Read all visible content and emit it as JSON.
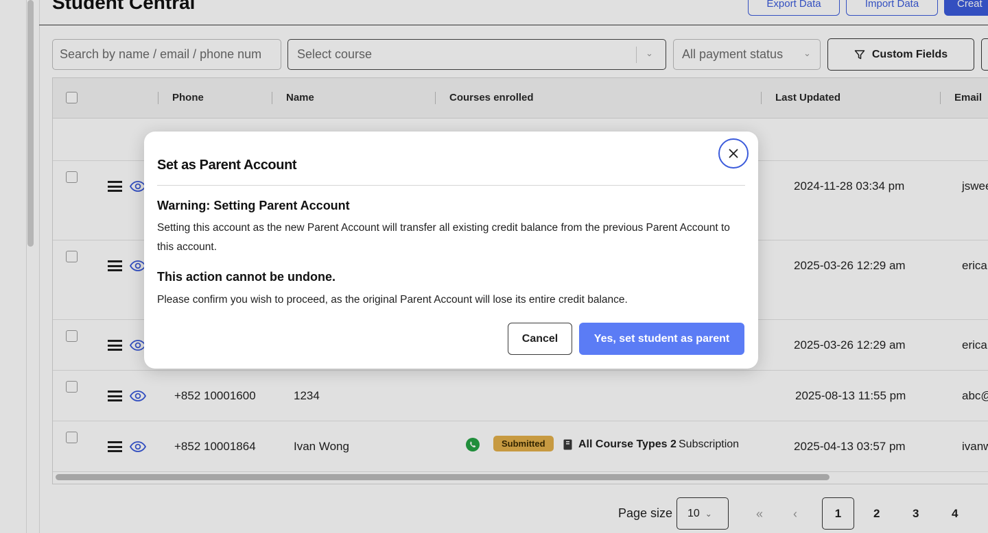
{
  "header": {
    "title": "Student Central",
    "buttons": {
      "export": "Export Data",
      "import": "Import Data",
      "create": "Creat"
    }
  },
  "filters": {
    "search_placeholder": "Search by name / email / phone num",
    "course_placeholder": "Select course",
    "payment_status": "All payment status",
    "custom_fields": "Custom Fields"
  },
  "table": {
    "columns": [
      "Phone",
      "Name",
      "Courses enrolled",
      "Last Updated",
      "Email"
    ],
    "rows": [
      {
        "phone": "",
        "name": "",
        "date": "2024-11-28 03:34 pm",
        "email": "jswee"
      },
      {
        "phone": "",
        "name": "",
        "date": "2025-03-26 12:29 am",
        "email": "erica"
      },
      {
        "phone": "",
        "name": "",
        "date": "2025-03-26 12:29 am",
        "email": "erica"
      },
      {
        "phone": "+852 10001600",
        "name": "1234",
        "date": "2025-08-13 11:55 pm",
        "email": "abc@"
      },
      {
        "phone": "+852 10001864",
        "name": "Ivan Wong",
        "date": "2025-04-13 03:57 pm",
        "email": "ivanw",
        "status": "Submitted",
        "course": "All Course Types 2",
        "course_type": "Subscription"
      }
    ]
  },
  "pagination": {
    "page_size_label": "Page size",
    "page_size": "10",
    "first": "«",
    "prev": "‹",
    "pages": [
      "1",
      "2",
      "3",
      "4"
    ],
    "current": "1"
  },
  "modal": {
    "title": "Set as Parent Account",
    "warning_heading": "Warning: Setting Parent Account",
    "warning_text": "Setting this account as the new Parent Account will transfer all existing credit balance from the previous Parent Account to this account.",
    "undo_heading": "This action cannot be undone.",
    "undo_text": "Please confirm you wish to proceed, as the original Parent Account will lose its entire credit balance.",
    "cancel": "Cancel",
    "confirm": "Yes, set student as parent"
  },
  "colors": {
    "accent": "#3b5bdb",
    "confirm_button": "#5b7cf5",
    "badge": "#e3b04b",
    "whatsapp": "#25a244"
  },
  "icons": [
    "close-icon",
    "filter-icon",
    "menu-icon",
    "eye-icon",
    "whatsapp-icon",
    "book-icon",
    "chevron-down-icon"
  ]
}
